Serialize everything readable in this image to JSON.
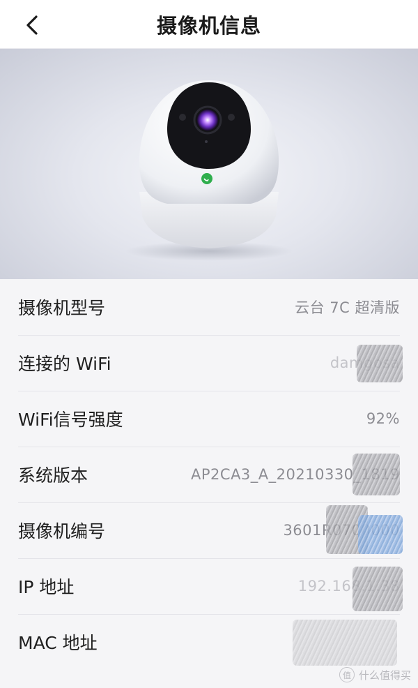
{
  "header": {
    "title": "摄像机信息",
    "back_icon": "chevron-left-icon"
  },
  "hero": {
    "image": "camera-product-photo"
  },
  "info": [
    {
      "label": "摄像机型号",
      "value": "云台 7C 超清版"
    },
    {
      "label": "连接的 WiFi",
      "value": "damgosa"
    },
    {
      "label": "WiFi信号强度",
      "value": "92%"
    },
    {
      "label": "系统版本",
      "value": "AP2CA3_A_20210330_1819"
    },
    {
      "label": "摄像机编号",
      "value": "3601R0700000"
    },
    {
      "label": "IP 地址",
      "value": "192.168.1.38"
    },
    {
      "label": "MAC 地址",
      "value": ""
    }
  ],
  "watermark": {
    "badge": "值",
    "text": "什么值得买"
  }
}
